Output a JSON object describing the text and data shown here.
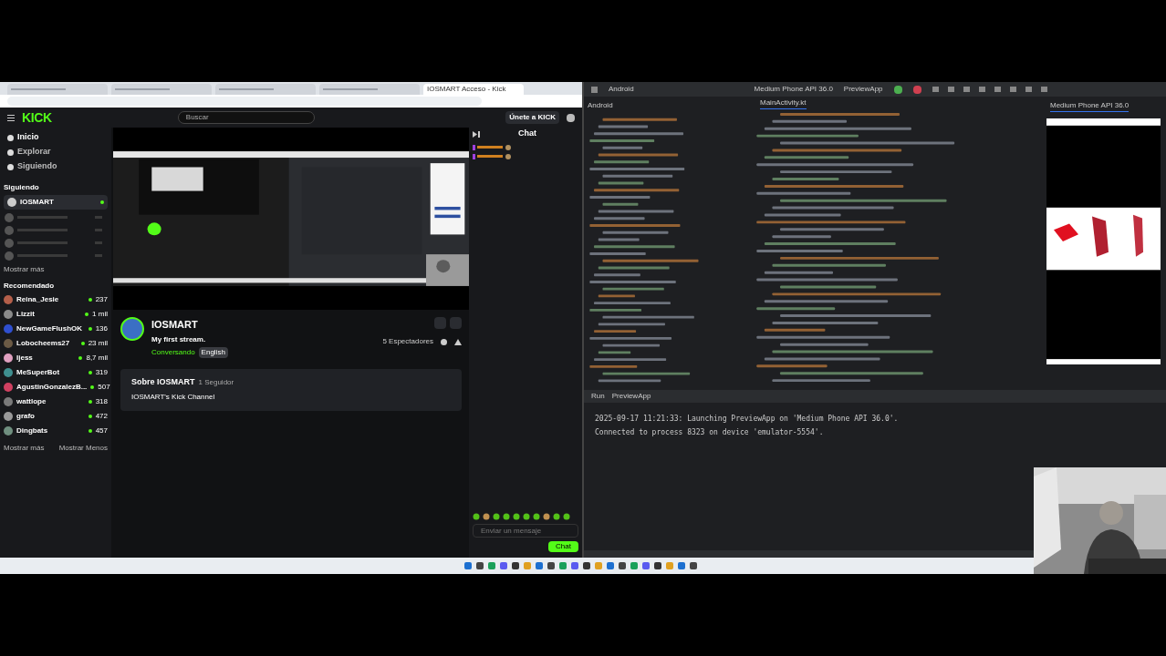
{
  "browser": {
    "tabs": [
      {
        "selected": false
      },
      {
        "selected": false
      },
      {
        "selected": false
      },
      {
        "selected": false
      },
      {
        "title": "IOSMART Acceso - Kick",
        "selected": true
      }
    ],
    "kick": {
      "logo": "KICK",
      "search": {
        "placeholder": "Buscar"
      },
      "join_button": "Únete a KICK",
      "nav": [
        {
          "label": "Inicio",
          "selected": true
        },
        {
          "label": "Explorar",
          "selected": false
        },
        {
          "label": "Siguiendo",
          "selected": false
        }
      ],
      "following_title": "Siguiendo",
      "following": [
        {
          "name": "IOSMART",
          "live": true
        }
      ],
      "show_more": "Mostrar más",
      "recommended_title": "Recomendado",
      "recommended": [
        {
          "name": "Reina_Jesie",
          "viewers": "237",
          "color": "#b45f4a"
        },
        {
          "name": "Lizzit",
          "viewers": "1 mil",
          "color": "#8a8a8a"
        },
        {
          "name": "NewGameFlushOK",
          "viewers": "136",
          "color": "#2f4fcf"
        },
        {
          "name": "Lobocheems27",
          "viewers": "23 mil",
          "color": "#6b5a45"
        },
        {
          "name": "Ijess",
          "viewers": "8,7 mil",
          "color": "#e0a0c0"
        },
        {
          "name": "MeSuperBot",
          "viewers": "319",
          "color": "#3f8f8f"
        },
        {
          "name": "AgustinGonzalezB...",
          "viewers": "507",
          "color": "#d04060"
        },
        {
          "name": "wattlope",
          "viewers": "318",
          "color": "#7a7a7a"
        },
        {
          "name": "grafo",
          "viewers": "472",
          "color": "#9a9a9a"
        },
        {
          "name": "Dingbats",
          "viewers": "457",
          "color": "#6f8f7f"
        }
      ],
      "show_more_bottom": "Mostrar más",
      "show_less": "Mostrar Menos",
      "channel": {
        "name": "IOSMART",
        "title": "My first stream.",
        "category": "Conversando",
        "language": "English",
        "viewers": "5 Espectadores"
      },
      "about": {
        "title": "Sobre IOSMART",
        "followers": "1 Seguidor",
        "description": "IOSMART's Kick Channel"
      },
      "chat": {
        "title": "Chat",
        "placeholder": "Enviar un mensaje",
        "send": "Chat"
      }
    }
  },
  "ide": {
    "project": "Android",
    "panel_title": "Android",
    "file_tab": "MainActivity.kt",
    "device": "Medium Phone API 36.0",
    "emulator_tab": "Medium Phone API 36.0",
    "run_config": "PreviewApp",
    "run_tab": "Run",
    "run_config_tab": "PreviewApp",
    "console": [
      "2025-09-17 11:21:33: Launching PreviewApp on 'Medium Phone API 36.0'.",
      "Connected to process 8323 on device 'emulator-5554'."
    ]
  }
}
